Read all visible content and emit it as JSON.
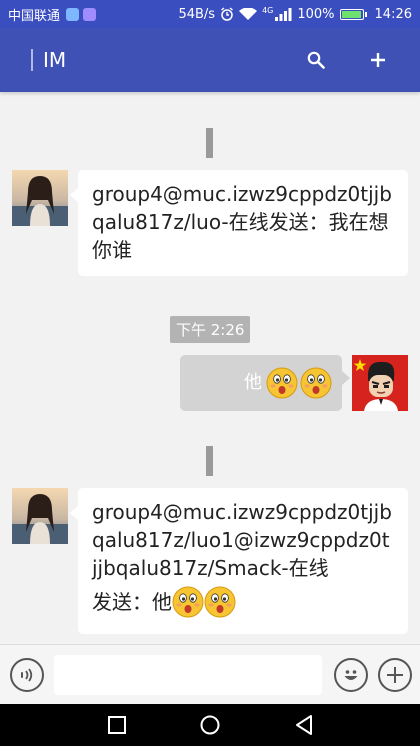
{
  "status_bar": {
    "carrier": "中国联通",
    "speed": "54B/s",
    "network": "4G",
    "battery": "100%",
    "time": "14:26"
  },
  "app_bar": {
    "title": "IM",
    "search_icon": "search-icon",
    "add_icon": "plus-icon"
  },
  "messages": [
    {
      "direction": "incoming",
      "text": "group4@muc.izwz9cppdz0tjjbqalu817z/luo-在线发送：我在想你谁"
    },
    {
      "timestamp": "下午 2:26"
    },
    {
      "direction": "outgoing",
      "text": "他",
      "emojis": [
        "surprised-face-icon",
        "surprised-face-icon"
      ]
    },
    {
      "direction": "incoming",
      "text": "group4@muc.izwz9cppdz0tjjbqalu817z/luo1@izwz9cppdz0tjjbqalu817z/Smack-在线",
      "text2": "发送：他",
      "emojis": [
        "surprised-face-icon",
        "surprised-face-icon"
      ]
    }
  ],
  "input_bar": {
    "voice_icon": "voice-icon",
    "message_value": "",
    "emoji_icon": "smiley-icon",
    "more_icon": "plus-circle-icon"
  },
  "nav_bar": {
    "icons": [
      "recent-apps-icon",
      "home-icon",
      "back-icon"
    ]
  },
  "colors": {
    "primary": "#3f51b5",
    "status_bar": "#3a4ec0",
    "background": "#f2f2f2",
    "outgoing_bubble": "#d3d3d3",
    "timestamp_chip": "#b3b3b3"
  }
}
